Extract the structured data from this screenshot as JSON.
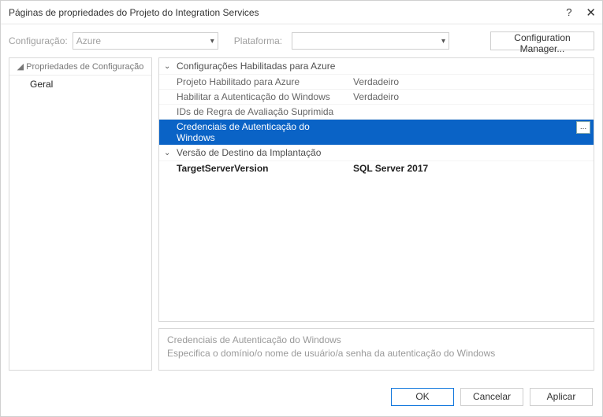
{
  "window": {
    "title": "Páginas de propriedades do Projeto do Integration Services"
  },
  "toolbar": {
    "config_label": "Configuração:",
    "config_value": "Azure",
    "platform_label": "Plataforma:",
    "platform_value": "",
    "config_manager_label": "Configuration Manager..."
  },
  "tree": {
    "header": "◢ Propriedades de Configuração",
    "item_geral": "Geral"
  },
  "groups": {
    "azure": {
      "header": "Configurações Habilitadas para Azure",
      "rows": {
        "projeto_habilitado": {
          "name": "Projeto Habilitado para Azure",
          "val": "Verdadeiro"
        },
        "habilitar_auth_win": {
          "name": "Habilitar a Autenticação do Windows",
          "val": "Verdadeiro"
        },
        "ids_regra": {
          "name": "IDs de Regra de Avaliação Suprimida",
          "val": ""
        },
        "credenciais_win": {
          "name": "Credenciais de Autenticação do Windows",
          "val": ""
        }
      }
    },
    "versao": {
      "header": "Versão de Destino da Implantação",
      "rows": {
        "target_server": {
          "name": "TargetServerVersion",
          "val": "SQL Server 2017"
        }
      }
    }
  },
  "desc": {
    "title": "Credenciais de Autenticação do Windows",
    "text": "Especifica o domínio/o nome de usuário/a senha da autenticação do Windows"
  },
  "footer": {
    "ok": "OK",
    "cancel": "Cancelar",
    "apply": "Aplicar"
  },
  "icons": {
    "ellipsis": "..."
  }
}
